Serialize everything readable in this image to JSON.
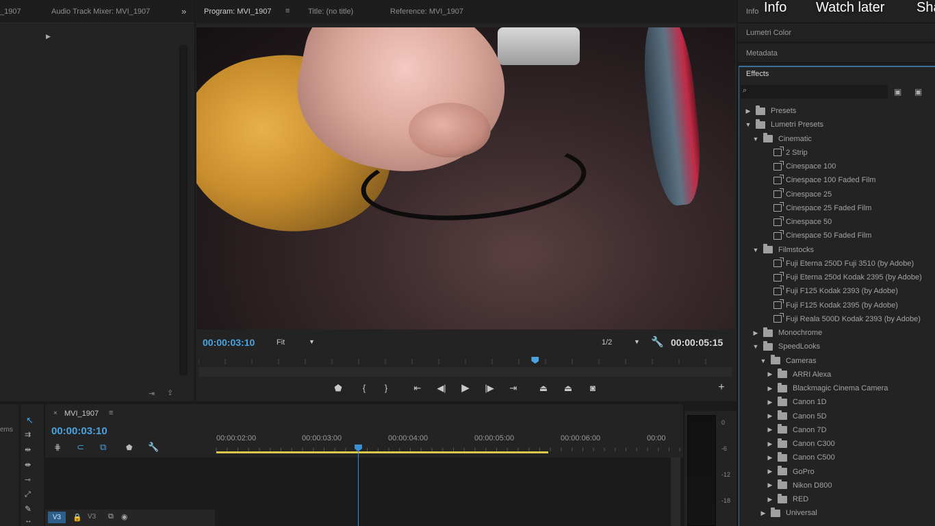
{
  "left_panel": {
    "tabs": [
      "_1907",
      "Audio Track Mixer: MVI_1907"
    ],
    "overflow_icon": "double-chevron-right-icon",
    "partial_label": "ems"
  },
  "program_monitor": {
    "tabs": {
      "program": "Program: MVI_1907",
      "title": "Title: (no title)",
      "reference": "Reference: MVI_1907"
    },
    "current_timecode": "00:00:03:10",
    "zoom": "Fit",
    "resolution": "1/2",
    "duration_timecode": "00:00:05:15",
    "playhead_fraction": 0.63
  },
  "youtube_overlay": {
    "info": "Info",
    "watch_later": "Watch later",
    "share": "Sha"
  },
  "right_panel": {
    "info_tab": "Info",
    "lumetri_tab": "Lumetri Color",
    "metadata_tab": "Metadata",
    "effects_title": "Effects",
    "tree": [
      {
        "label": "Presets",
        "level": 0,
        "kind": "folder",
        "expanded": false
      },
      {
        "label": "Lumetri Presets",
        "level": 0,
        "kind": "folder",
        "expanded": true
      },
      {
        "label": "Cinematic",
        "level": 1,
        "kind": "folder",
        "expanded": true
      },
      {
        "label": "2 Strip",
        "level": 2,
        "kind": "preset"
      },
      {
        "label": "Cinespace 100",
        "level": 2,
        "kind": "preset"
      },
      {
        "label": "Cinespace 100 Faded Film",
        "level": 2,
        "kind": "preset"
      },
      {
        "label": "Cinespace 25",
        "level": 2,
        "kind": "preset"
      },
      {
        "label": "Cinespace 25 Faded Film",
        "level": 2,
        "kind": "preset"
      },
      {
        "label": "Cinespace 50",
        "level": 2,
        "kind": "preset"
      },
      {
        "label": "Cinespace 50 Faded Film",
        "level": 2,
        "kind": "preset"
      },
      {
        "label": "Filmstocks",
        "level": 1,
        "kind": "folder",
        "expanded": true
      },
      {
        "label": "Fuji Eterna 250D Fuji 3510 (by Adobe)",
        "level": 2,
        "kind": "preset"
      },
      {
        "label": "Fuji Eterna 250d Kodak 2395 (by Adobe)",
        "level": 2,
        "kind": "preset"
      },
      {
        "label": "Fuji F125 Kodak 2393 (by Adobe)",
        "level": 2,
        "kind": "preset"
      },
      {
        "label": "Fuji F125 Kodak 2395 (by Adobe)",
        "level": 2,
        "kind": "preset"
      },
      {
        "label": "Fuji Reala 500D Kodak 2393 (by Adobe)",
        "level": 2,
        "kind": "preset"
      },
      {
        "label": "Monochrome",
        "level": 1,
        "kind": "folder",
        "expanded": false
      },
      {
        "label": "SpeedLooks",
        "level": 1,
        "kind": "folder",
        "expanded": true
      },
      {
        "label": "Cameras",
        "level": 2,
        "kind": "folder",
        "expanded": true
      },
      {
        "label": "ARRI Alexa",
        "level": 3,
        "kind": "folder",
        "expanded": false
      },
      {
        "label": "Blackmagic Cinema Camera",
        "level": 3,
        "kind": "folder",
        "expanded": false
      },
      {
        "label": "Canon 1D",
        "level": 3,
        "kind": "folder",
        "expanded": false
      },
      {
        "label": "Canon 5D",
        "level": 3,
        "kind": "folder",
        "expanded": false
      },
      {
        "label": "Canon 7D",
        "level": 3,
        "kind": "folder",
        "expanded": false
      },
      {
        "label": "Canon C300",
        "level": 3,
        "kind": "folder",
        "expanded": false
      },
      {
        "label": "Canon C500",
        "level": 3,
        "kind": "folder",
        "expanded": false
      },
      {
        "label": "GoPro",
        "level": 3,
        "kind": "folder",
        "expanded": false
      },
      {
        "label": "Nikon D800",
        "level": 3,
        "kind": "folder",
        "expanded": false
      },
      {
        "label": "RED",
        "level": 3,
        "kind": "folder",
        "expanded": false
      },
      {
        "label": "Universal",
        "level": 2,
        "kind": "folder",
        "expanded": false
      }
    ]
  },
  "timeline": {
    "sequence_name": "MVI_1907",
    "current_timecode": "00:00:03:10",
    "ruler_labels": [
      "00:00:02:00",
      "00:00:03:00",
      "00:00:04:00",
      "00:00:05:00",
      "00:00:06:00",
      "00:00"
    ],
    "track_v3": "V3",
    "track_v3_target": "V3"
  },
  "audio_meter": {
    "labels": [
      "0",
      "-6",
      "-12",
      "-18"
    ]
  },
  "colors": {
    "accent_blue": "#4aa3e0",
    "workarea_yellow": "#d8c84a"
  }
}
